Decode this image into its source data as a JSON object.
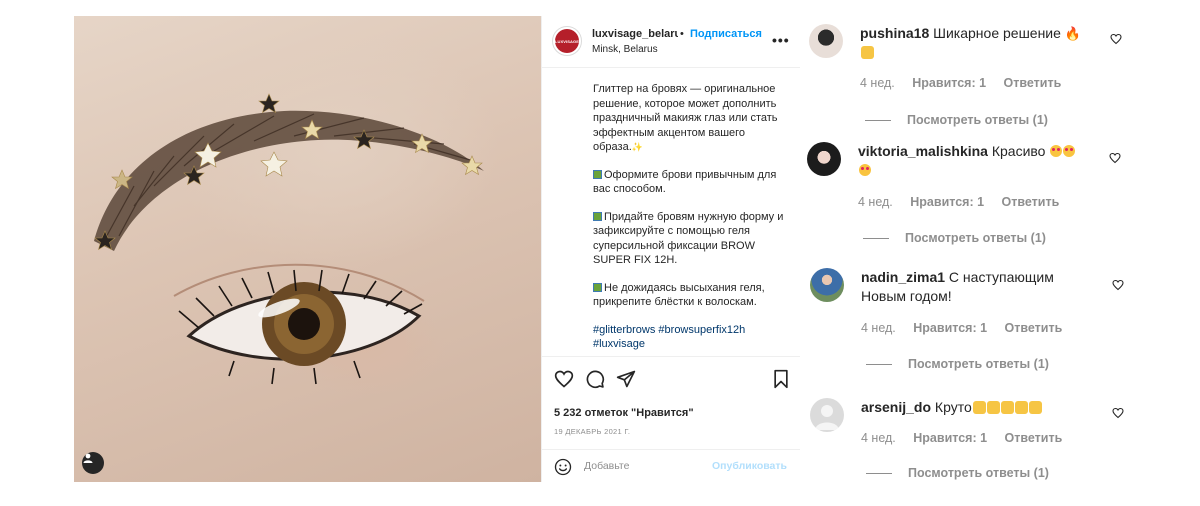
{
  "post": {
    "username": "luxvisage_belarus",
    "follow_label": "Подписаться",
    "separator": "•",
    "location": "Minsk, Belarus",
    "avatar_text": "LUXVISAGE",
    "more_label": "•••",
    "caption": {
      "p1": "Глиттер на бровях — оригинальное решение, которое может дополнить праздничный макияж глаз или стать эффектным акцентом вашего образа.",
      "p2": "Оформите брови привычным для вас способом.",
      "p3": "Придайте бровям нужную форму и зафиксируйте с помощью геля суперсильной фиксации BROW SUPER FIX 12H.",
      "p4": "Не дожидаясь высыхания геля, прикрепите блёстки к волоскам.",
      "hashtags": "#glitterbrows #browsuperfix12h #luxvisage"
    },
    "likes": "5 232 отметок \"Нравится\"",
    "date": "19 ДЕКАБРЬ 2021 Г.",
    "comment_placeholder": "Добавьте",
    "publish_label": "Опубликовать"
  },
  "comments": [
    {
      "user": "pushina18",
      "text": "Шикарное решение",
      "emoji": "fire, raised-hands",
      "age": "4 нед.",
      "likes": "Нравится: 1",
      "reply": "Ответить",
      "replies": "Посмотреть ответы (1)"
    },
    {
      "user": "viktoria_malishkina",
      "text": "Красиво",
      "emoji": "heart-eyes x3",
      "age": "4 нед.",
      "likes": "Нравится: 1",
      "reply": "Ответить",
      "replies": "Посмотреть ответы (1)"
    },
    {
      "user": "nadin_zima1",
      "text": "С наступающим Новым годом!",
      "age": "4 нед.",
      "likes": "Нравится: 1",
      "reply": "Ответить",
      "replies": "Посмотреть ответы (1)"
    },
    {
      "user": "arsenij_do",
      "text": "Круто",
      "emoji": "raised-hands x5",
      "age": "4 нед.",
      "likes": "Нравится: 1",
      "reply": "Ответить",
      "replies": "Посмотреть ответы (1)"
    }
  ],
  "icons": {
    "like": "heart-outline-icon",
    "comment": "comment-bubble-icon",
    "share": "paper-plane-icon",
    "save": "bookmark-icon",
    "emoji": "smiley-icon",
    "user_tag": "person-icon"
  },
  "colors": {
    "link_blue": "#0095f6",
    "publish_disabled": "#b2dffc",
    "muted_text": "#8e8e8e",
    "brand_red": "#b51f2a"
  }
}
